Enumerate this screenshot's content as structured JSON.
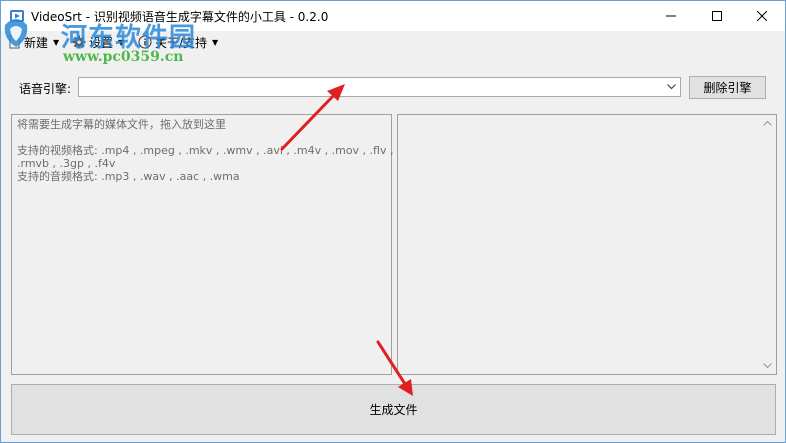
{
  "window": {
    "title": "VideoSrt - 识别视频语音生成字幕文件的小工具 - 0.2.0"
  },
  "menu": {
    "items": [
      {
        "label": "新建",
        "icon": "new-doc-icon"
      },
      {
        "label": "设置",
        "icon": "gear-icon"
      },
      {
        "label": "关于/支持",
        "icon": "info-icon"
      }
    ]
  },
  "watermark": {
    "brand": "河东软件园",
    "url": "www.pc0359.cn"
  },
  "engine": {
    "label": "语音引擎:",
    "selected": "",
    "delete_label": "删除引擎"
  },
  "drop_area": {
    "hint": "将需要生成字幕的媒体文件，拖入放到这里",
    "video_formats_line1": "支持的视频格式: .mp4 , .mpeg , .mkv , .wmv , .avi , .m4v , .mov , .flv ,",
    "video_formats_line2": ".rmvb , .3gp , .f4v",
    "audio_formats": "支持的音频格式: .mp3 , .wav , .aac , .wma"
  },
  "generate_label": "生成文件",
  "colors": {
    "accent_arrow": "#e02020",
    "brand_blue": "#2a8ad8",
    "brand_green": "#4fb84b"
  }
}
